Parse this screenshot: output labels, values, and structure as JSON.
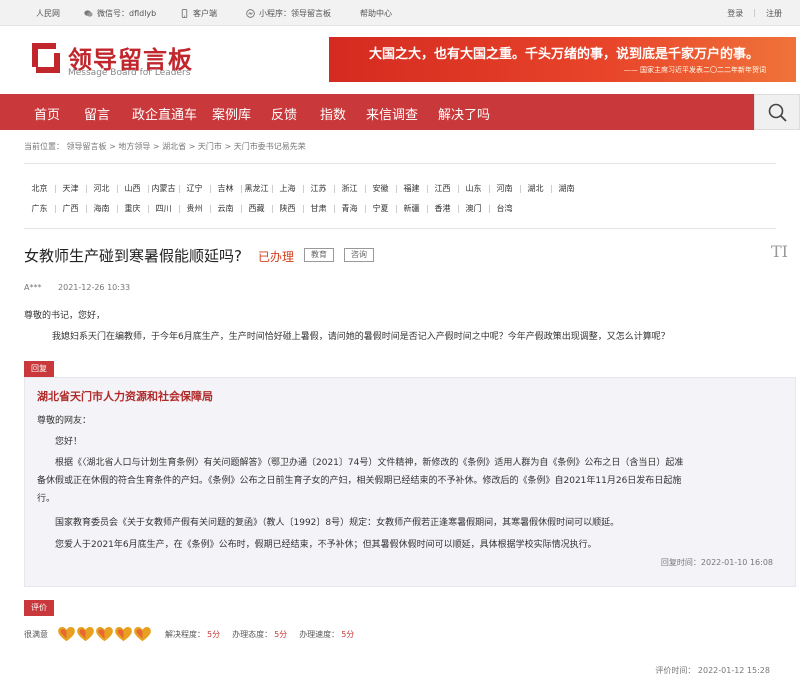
{
  "topbar": {
    "people": "人民网",
    "wechat": "微信号：dfldlyb",
    "client": "客户端",
    "miniprogram": "小程序：领导留言板",
    "help": "帮助中心",
    "login": "登录",
    "separator": "|",
    "register": "注册"
  },
  "header": {
    "logo_title": "领导留言板",
    "logo_sub": "Message Board for Leaders",
    "banner_main": "大国之大，也有大国之重。千头万绪的事，说到底是千家万户的事。",
    "banner_sub": "—— 国家主席习近平发表二〇二二年新年贺词"
  },
  "nav": {
    "items": [
      "首页",
      "留言",
      "政企直通车",
      "案例库",
      "反馈",
      "指数",
      "来信调查",
      "解决了吗"
    ]
  },
  "breadcrumb": "当前位置： 领导留言板 > 地方领导 > 湖北省 > 天门市 > 天门市委书记易先荣",
  "regions": {
    "row1": [
      "北京",
      "天津",
      "河北",
      "山西",
      "内蒙古",
      "辽宁",
      "吉林",
      "黑龙江",
      "上海",
      "江苏",
      "浙江",
      "安徽",
      "福建",
      "江西",
      "山东",
      "河南",
      "湖北",
      "湖南"
    ],
    "row2": [
      "广东",
      "广西",
      "海南",
      "重庆",
      "四川",
      "贵州",
      "云南",
      "西藏",
      "陕西",
      "甘肃",
      "青海",
      "宁夏",
      "新疆",
      "香港",
      "澳门",
      "台湾"
    ]
  },
  "message": {
    "title": "女教师生产碰到寒暑假能顺延吗?",
    "status": "已办理",
    "tags": [
      "教育",
      "咨询"
    ],
    "font_icon": "TI",
    "author": "A***",
    "time": "2021-12-26 10:33",
    "greeting": "尊敬的书记，您好，",
    "body": "我媳妇系天门在编教师，于今年6月底生产，生产时间恰好碰上暑假，请问她的暑假时间是否记入产假时间之中呢？今年产假政策出现调整，又怎么计算呢？"
  },
  "reply": {
    "label": "回复",
    "org": "湖北省天门市人力资源和社会保障局",
    "salutation": "尊敬的网友：",
    "hello": "您好！",
    "p1a": "根据《〈湖北省人口与计划生育条例〉有关问题解答》（鄂卫办通〔2021〕74号）文件精神，新修改的《条例》适用人群为自《条例》公布之日（含当日）起准",
    "p1b": "备休假或正在休假的符合生育条件的产妇。《条例》公布之日前生育子女的产妇，相关假期已经结束的不予补休。修改后的《条例》自2021年11月26日发布日起施",
    "p1c": "行。",
    "p2": "国家教育委员会《关于女教师产假有关问题的复函》（教人〔1992〕8号）规定：女教师产假若正逢寒暑假期间，其寒暑假休假时间可以顺延。",
    "p3": "您爱人于2021年6月底生产，在《条例》公布时，假期已经结束，不予补休；但其暑假休假时间可以顺延，具体根据学校实际情况执行。",
    "time": "回复时间：2022-01-10 16:08"
  },
  "evaluation": {
    "label": "评价",
    "level": "很满意",
    "hearts": 5,
    "heart_color": "#e8a020",
    "items": [
      {
        "label": "解决程度：",
        "score": "5分"
      },
      {
        "label": "办理态度：",
        "score": "5分"
      },
      {
        "label": "办理速度：",
        "score": "5分"
      }
    ],
    "time": "评价时间： 2022-01-12 15:28"
  }
}
